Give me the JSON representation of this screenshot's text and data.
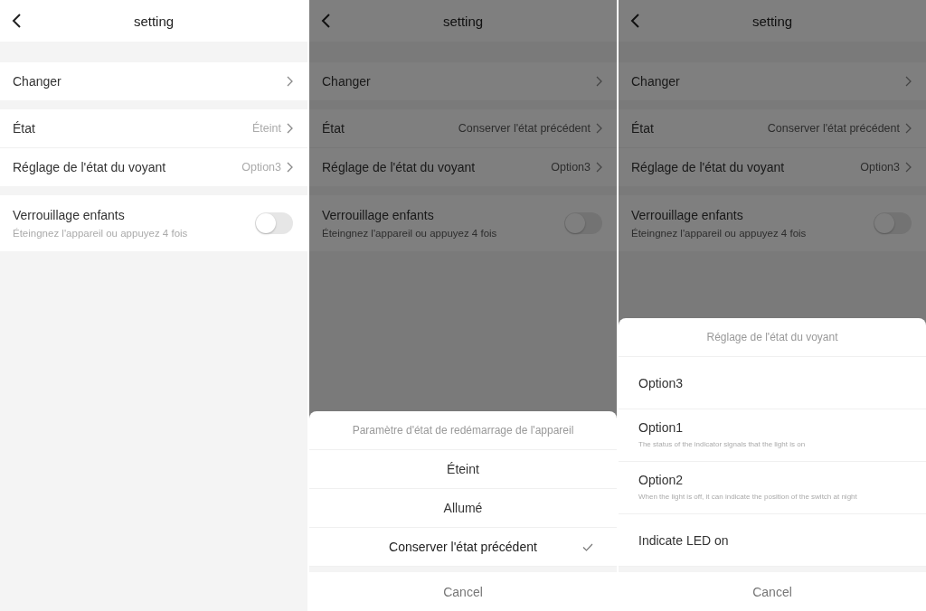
{
  "screens": [
    {
      "title": "setting",
      "groups": [
        [
          {
            "kind": "link",
            "label": "Changer"
          }
        ],
        [
          {
            "kind": "link",
            "label": "État",
            "value": "Éteint"
          },
          {
            "kind": "link",
            "label": "Réglage de l'état du voyant",
            "value": "Option3"
          }
        ],
        [
          {
            "kind": "toggle",
            "label": "Verrouillage enfants",
            "sublabel": "Éteingnez l'appareil ou appuyez 4 fois",
            "on": false
          }
        ]
      ]
    },
    {
      "title": "setting",
      "groups": [
        [
          {
            "kind": "link",
            "label": "Changer"
          }
        ],
        [
          {
            "kind": "link",
            "label": "État",
            "value": "Conserver l'état précédent"
          },
          {
            "kind": "link",
            "label": "Réglage de l'état du voyant",
            "value": "Option3"
          }
        ],
        [
          {
            "kind": "toggle",
            "label": "Verrouillage enfants",
            "sublabel": "Éteingnez l'appareil ou appuyez 4 fois",
            "on": false
          }
        ]
      ],
      "sheet": {
        "title": "Paramètre d'état de redémarrage de l'appareil",
        "options": [
          {
            "label": "Éteint",
            "selected": false
          },
          {
            "label": "Allumé",
            "selected": false
          },
          {
            "label": "Conserver l'état précédent",
            "selected": true
          }
        ],
        "cancel": "Cancel"
      }
    },
    {
      "title": "setting",
      "groups": [
        [
          {
            "kind": "link",
            "label": "Changer"
          }
        ],
        [
          {
            "kind": "link",
            "label": "État",
            "value": "Conserver l'état précédent"
          },
          {
            "kind": "link",
            "label": "Réglage de l'état du voyant",
            "value": "Option3"
          }
        ],
        [
          {
            "kind": "toggle",
            "label": "Verrouillage enfants",
            "sublabel": "Éteingnez l'appareil ou appuyez 4 fois",
            "on": false
          }
        ]
      ],
      "sheet": {
        "title": "Réglage de l'état du voyant",
        "options": [
          {
            "label": "Option3",
            "selected": false
          },
          {
            "label": "Option1",
            "description": "The status of the indicator signals that the light is on",
            "selected": false
          },
          {
            "label": "Option2",
            "description": "When the light is off, it can indicate the position of the switch at night",
            "selected": false
          },
          {
            "label": "Indicate LED on",
            "selected": false
          }
        ],
        "cancel": "Cancel"
      }
    }
  ]
}
